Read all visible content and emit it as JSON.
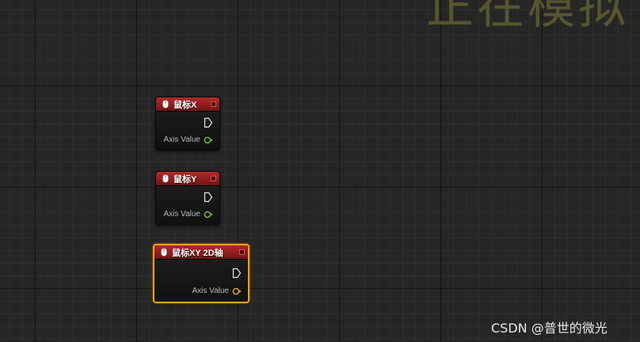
{
  "comment": {
    "title": "正在模拟"
  },
  "nodes": [
    {
      "title": "鼠标X",
      "icon": "mouse-icon",
      "output_pin_label": "Axis Value",
      "selected": false
    },
    {
      "title": "鼠标Y",
      "icon": "mouse-icon",
      "output_pin_label": "Axis Value",
      "selected": false
    },
    {
      "title": "鼠标XY 2D轴",
      "icon": "mouse-icon",
      "output_pin_label": "Axis Value",
      "selected": true
    }
  ],
  "colors": {
    "canvas_background": "#262626",
    "node_header": "#8a1d1d",
    "selection_outline": "#f0a020",
    "axis_pin_float": "#7cc24a",
    "axis_pin_vector2d": "#e8b040",
    "comment_text": "#56562e"
  },
  "watermark": {
    "text": "CSDN @普世的微光"
  }
}
